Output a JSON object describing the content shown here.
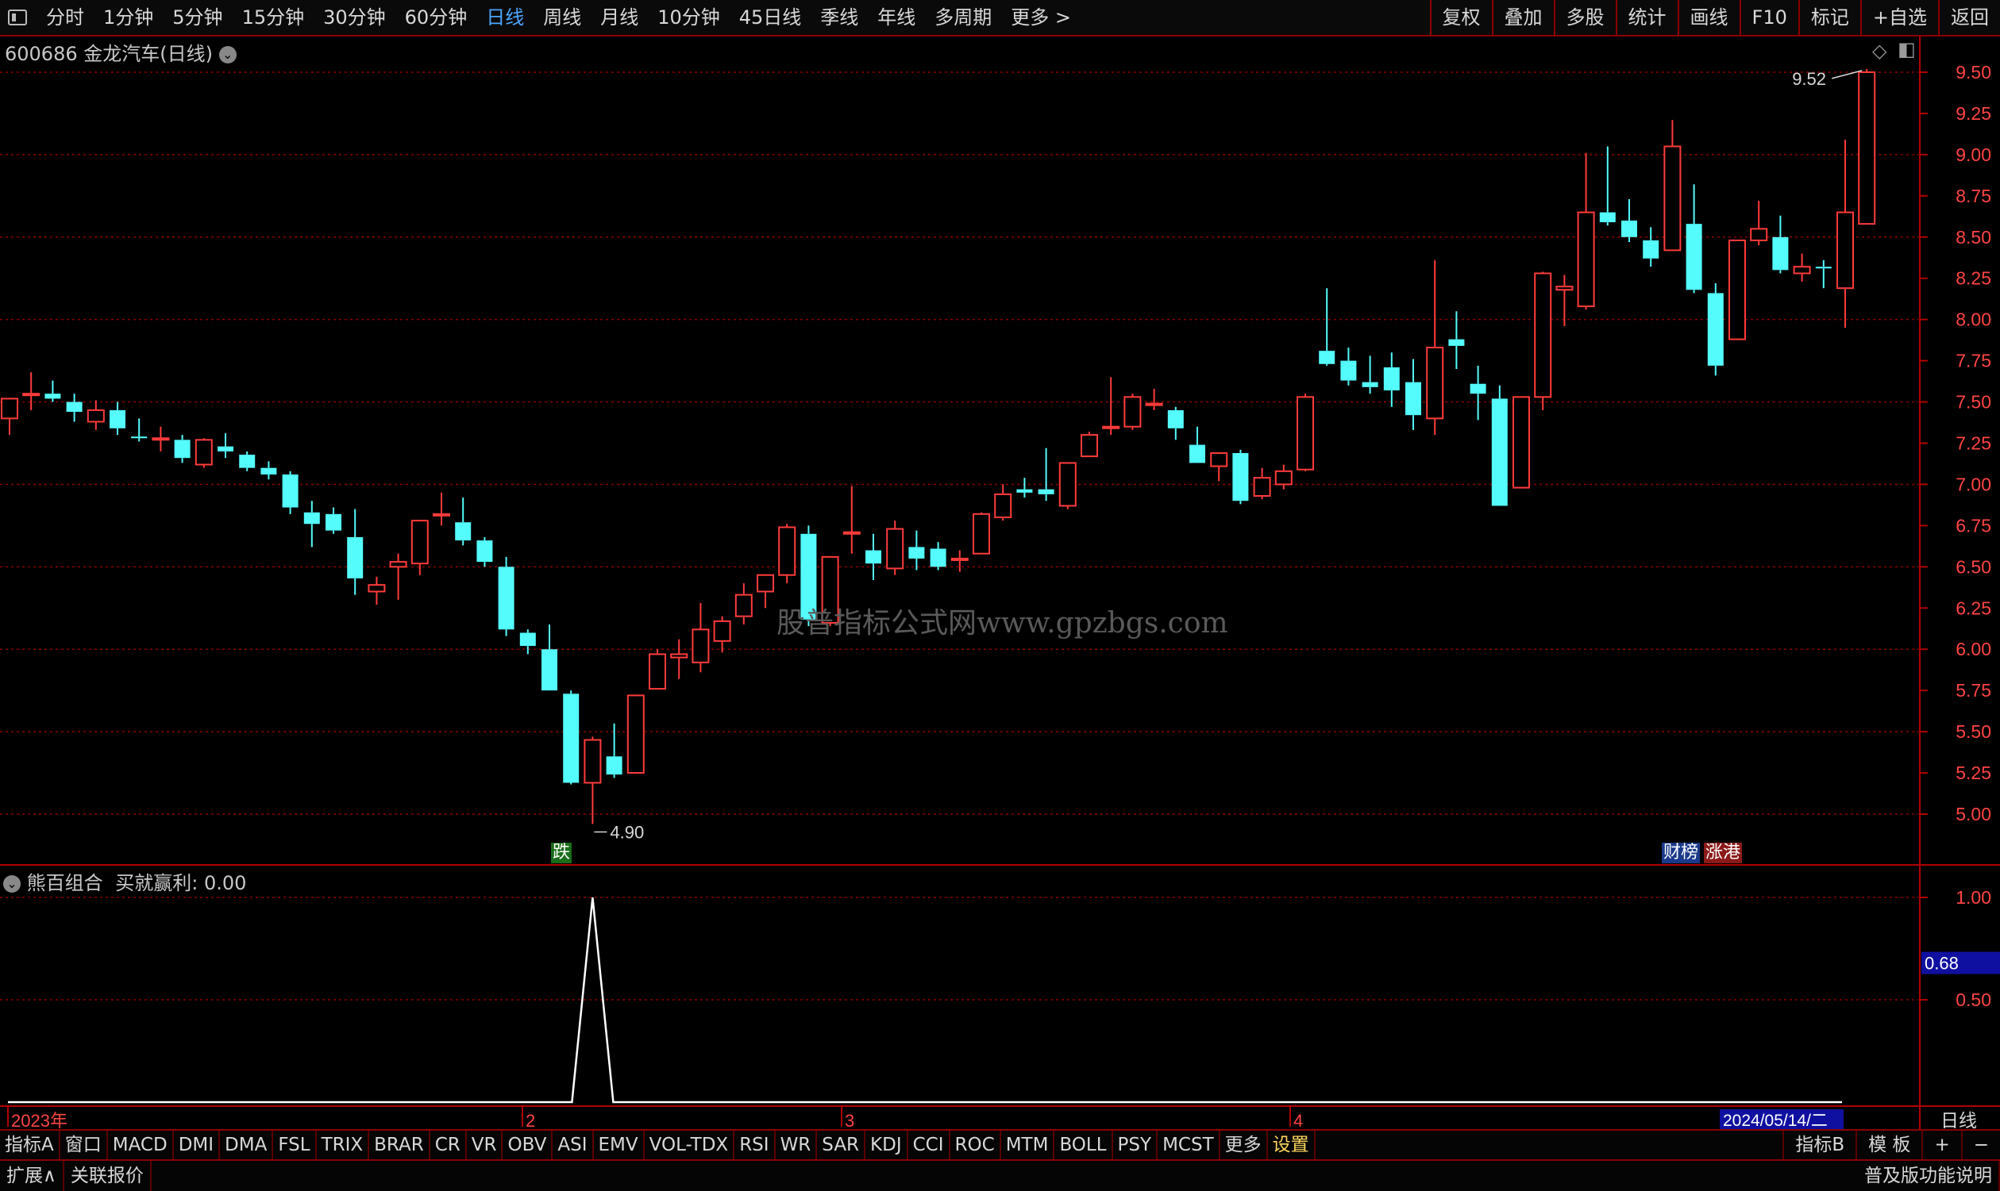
{
  "toolbar": {
    "periods": [
      "分时",
      "1分钟",
      "5分钟",
      "15分钟",
      "30分钟",
      "60分钟",
      "日线",
      "周线",
      "月线",
      "10分钟",
      "45日线",
      "季线",
      "年线",
      "多周期",
      "更多 >"
    ],
    "active_period": "日线",
    "right_buttons": [
      "复权",
      "叠加",
      "多股",
      "统计",
      "画线",
      "F10",
      "标记",
      "+自选",
      "返回"
    ]
  },
  "chart_header": {
    "code": "600686",
    "name_period": "金龙汽车(日线)"
  },
  "indicator_header": {
    "name": "熊百组合",
    "value_text": "买就赢利: 0.00"
  },
  "watermark": "股普指标公式网www.gpzbgs.com",
  "annotations": {
    "high_label": "9.52",
    "low_label": "4.90",
    "signal_tag": "跌",
    "tag_caibang": "财榜",
    "tag_zhanggang": "涨港"
  },
  "colors": {
    "up": "#ff3b3b",
    "down": "#54fcfc",
    "grid": "#8b0000",
    "frame": "#b00000"
  },
  "chart_data": {
    "type": "candlestick",
    "price_axis": {
      "min": 4.8,
      "max": 9.6,
      "ticks": [
        "9.50",
        "9.25",
        "9.00",
        "8.75",
        "8.50",
        "8.25",
        "8.00",
        "7.75",
        "7.50",
        "7.25",
        "7.00",
        "6.75",
        "6.50",
        "6.25",
        "6.00",
        "5.75",
        "5.50",
        "5.25",
        "5.00"
      ]
    },
    "indicator_axis": {
      "ticks": [
        "1.00",
        "0.50"
      ],
      "current": "0.68"
    },
    "x_labels": [
      "2023年",
      "2",
      "3",
      "4"
    ],
    "current_date": "2024/05/14/二",
    "period_label": "日线",
    "candles": [
      {
        "o": 7.4,
        "h": 7.5,
        "l": 7.3,
        "c": 7.52
      },
      {
        "o": 7.55,
        "h": 7.68,
        "l": 7.45,
        "c": 7.55
      },
      {
        "o": 7.55,
        "h": 7.63,
        "l": 7.5,
        "c": 7.52
      },
      {
        "o": 7.5,
        "h": 7.55,
        "l": 7.38,
        "c": 7.44
      },
      {
        "o": 7.38,
        "h": 7.51,
        "l": 7.33,
        "c": 7.45
      },
      {
        "o": 7.45,
        "h": 7.5,
        "l": 7.3,
        "c": 7.34
      },
      {
        "o": 7.29,
        "h": 7.4,
        "l": 7.26,
        "c": 7.28
      },
      {
        "o": 7.28,
        "h": 7.35,
        "l": 7.2,
        "c": 7.28
      },
      {
        "o": 7.27,
        "h": 7.3,
        "l": 7.13,
        "c": 7.16
      },
      {
        "o": 7.12,
        "h": 7.28,
        "l": 7.1,
        "c": 7.27
      },
      {
        "o": 7.23,
        "h": 7.31,
        "l": 7.16,
        "c": 7.2
      },
      {
        "o": 7.18,
        "h": 7.2,
        "l": 7.08,
        "c": 7.1
      },
      {
        "o": 7.1,
        "h": 7.14,
        "l": 7.03,
        "c": 7.06
      },
      {
        "o": 7.06,
        "h": 7.08,
        "l": 6.82,
        "c": 6.86
      },
      {
        "o": 6.83,
        "h": 6.9,
        "l": 6.62,
        "c": 6.76
      },
      {
        "o": 6.82,
        "h": 6.86,
        "l": 6.7,
        "c": 6.72
      },
      {
        "o": 6.68,
        "h": 6.85,
        "l": 6.33,
        "c": 6.43
      },
      {
        "o": 6.35,
        "h": 6.44,
        "l": 6.27,
        "c": 6.39
      },
      {
        "o": 6.5,
        "h": 6.58,
        "l": 6.3,
        "c": 6.53
      },
      {
        "o": 6.52,
        "h": 6.78,
        "l": 6.45,
        "c": 6.78
      },
      {
        "o": 6.82,
        "h": 6.95,
        "l": 6.75,
        "c": 6.82
      },
      {
        "o": 6.77,
        "h": 6.92,
        "l": 6.63,
        "c": 6.66
      },
      {
        "o": 6.66,
        "h": 6.68,
        "l": 6.5,
        "c": 6.53
      },
      {
        "o": 6.5,
        "h": 6.56,
        "l": 6.08,
        "c": 6.12
      },
      {
        "o": 6.1,
        "h": 6.12,
        "l": 5.97,
        "c": 6.02
      },
      {
        "o": 6.0,
        "h": 6.15,
        "l": 5.75,
        "c": 5.75
      },
      {
        "o": 5.73,
        "h": 5.75,
        "l": 5.18,
        "c": 5.19
      },
      {
        "o": 5.19,
        "h": 5.47,
        "l": 4.94,
        "c": 5.45
      },
      {
        "o": 5.35,
        "h": 5.55,
        "l": 5.22,
        "c": 5.24
      },
      {
        "o": 5.25,
        "h": 5.72,
        "l": 5.25,
        "c": 5.72
      },
      {
        "o": 5.76,
        "h": 6.0,
        "l": 5.76,
        "c": 5.97
      },
      {
        "o": 5.95,
        "h": 6.06,
        "l": 5.82,
        "c": 5.97
      },
      {
        "o": 5.92,
        "h": 6.28,
        "l": 5.86,
        "c": 6.12
      },
      {
        "o": 6.05,
        "h": 6.2,
        "l": 5.98,
        "c": 6.17
      },
      {
        "o": 6.2,
        "h": 6.4,
        "l": 6.15,
        "c": 6.33
      },
      {
        "o": 6.35,
        "h": 6.45,
        "l": 6.25,
        "c": 6.45
      },
      {
        "o": 6.45,
        "h": 6.76,
        "l": 6.4,
        "c": 6.74
      },
      {
        "o": 6.7,
        "h": 6.75,
        "l": 6.14,
        "c": 6.18
      },
      {
        "o": 6.16,
        "h": 6.56,
        "l": 6.14,
        "c": 6.56
      },
      {
        "o": 6.7,
        "h": 6.99,
        "l": 6.58,
        "c": 6.71
      },
      {
        "o": 6.6,
        "h": 6.7,
        "l": 6.42,
        "c": 6.52
      },
      {
        "o": 6.49,
        "h": 6.78,
        "l": 6.45,
        "c": 6.73
      },
      {
        "o": 6.62,
        "h": 6.72,
        "l": 6.48,
        "c": 6.55
      },
      {
        "o": 6.61,
        "h": 6.65,
        "l": 6.48,
        "c": 6.5
      },
      {
        "o": 6.55,
        "h": 6.6,
        "l": 6.47,
        "c": 6.55
      },
      {
        "o": 6.58,
        "h": 6.83,
        "l": 6.58,
        "c": 6.82
      },
      {
        "o": 6.8,
        "h": 7.0,
        "l": 6.78,
        "c": 6.94
      },
      {
        "o": 6.97,
        "h": 7.04,
        "l": 6.92,
        "c": 6.95
      },
      {
        "o": 6.97,
        "h": 7.22,
        "l": 6.9,
        "c": 6.94
      },
      {
        "o": 6.87,
        "h": 7.13,
        "l": 6.85,
        "c": 7.13
      },
      {
        "o": 7.17,
        "h": 7.32,
        "l": 7.17,
        "c": 7.3
      },
      {
        "o": 7.35,
        "h": 7.65,
        "l": 7.3,
        "c": 7.35
      },
      {
        "o": 7.35,
        "h": 7.55,
        "l": 7.33,
        "c": 7.53
      },
      {
        "o": 7.49,
        "h": 7.58,
        "l": 7.45,
        "c": 7.49
      },
      {
        "o": 7.45,
        "h": 7.47,
        "l": 7.27,
        "c": 7.34
      },
      {
        "o": 7.24,
        "h": 7.35,
        "l": 7.16,
        "c": 7.13
      },
      {
        "o": 7.11,
        "h": 7.14,
        "l": 7.02,
        "c": 7.19
      },
      {
        "o": 7.19,
        "h": 7.21,
        "l": 6.88,
        "c": 6.9
      },
      {
        "o": 6.93,
        "h": 7.1,
        "l": 6.91,
        "c": 7.04
      },
      {
        "o": 7.0,
        "h": 7.12,
        "l": 6.97,
        "c": 7.08
      },
      {
        "o": 7.09,
        "h": 7.55,
        "l": 7.08,
        "c": 7.53
      },
      {
        "o": 7.81,
        "h": 8.19,
        "l": 7.72,
        "c": 7.73
      },
      {
        "o": 7.75,
        "h": 7.83,
        "l": 7.6,
        "c": 7.63
      },
      {
        "o": 7.62,
        "h": 7.78,
        "l": 7.55,
        "c": 7.59
      },
      {
        "o": 7.71,
        "h": 7.8,
        "l": 7.47,
        "c": 7.57
      },
      {
        "o": 7.62,
        "h": 7.76,
        "l": 7.33,
        "c": 7.42
      },
      {
        "o": 7.4,
        "h": 8.36,
        "l": 7.3,
        "c": 7.83
      },
      {
        "o": 7.88,
        "h": 8.05,
        "l": 7.7,
        "c": 7.84
      },
      {
        "o": 7.61,
        "h": 7.72,
        "l": 7.39,
        "c": 7.55
      },
      {
        "o": 7.52,
        "h": 7.6,
        "l": 6.88,
        "c": 6.87
      },
      {
        "o": 6.98,
        "h": 7.53,
        "l": 6.98,
        "c": 7.53
      },
      {
        "o": 7.53,
        "h": 8.29,
        "l": 7.45,
        "c": 8.28
      },
      {
        "o": 8.18,
        "h": 8.27,
        "l": 7.96,
        "c": 8.2
      },
      {
        "o": 8.08,
        "h": 9.01,
        "l": 8.06,
        "c": 8.65
      },
      {
        "o": 8.65,
        "h": 9.05,
        "l": 8.57,
        "c": 8.59
      },
      {
        "o": 8.6,
        "h": 8.73,
        "l": 8.47,
        "c": 8.5
      },
      {
        "o": 8.48,
        "h": 8.56,
        "l": 8.32,
        "c": 8.37
      },
      {
        "o": 8.42,
        "h": 9.21,
        "l": 8.42,
        "c": 9.05
      },
      {
        "o": 8.58,
        "h": 8.82,
        "l": 8.16,
        "c": 8.18
      },
      {
        "o": 8.16,
        "h": 8.22,
        "l": 7.66,
        "c": 7.72
      },
      {
        "o": 7.88,
        "h": 8.48,
        "l": 7.88,
        "c": 8.48
      },
      {
        "o": 8.48,
        "h": 8.72,
        "l": 8.45,
        "c": 8.55
      },
      {
        "o": 8.5,
        "h": 8.63,
        "l": 8.28,
        "c": 8.3
      },
      {
        "o": 8.28,
        "h": 8.4,
        "l": 8.23,
        "c": 8.32
      },
      {
        "o": 8.32,
        "h": 8.36,
        "l": 8.19,
        "c": 8.31
      },
      {
        "o": 8.19,
        "h": 9.09,
        "l": 7.95,
        "c": 8.65
      },
      {
        "o": 8.58,
        "h": 9.52,
        "l": 8.58,
        "c": 9.5
      }
    ],
    "indicator_signal": {
      "candle_index": 27,
      "value": 1.0
    }
  },
  "bottom_tabs": [
    "指标A",
    "窗口",
    "MACD",
    "DMI",
    "DMA",
    "FSL",
    "TRIX",
    "BRAR",
    "CR",
    "VR",
    "OBV",
    "ASI",
    "EMV",
    "VOL-TDX",
    "RSI",
    "WR",
    "SAR",
    "KDJ",
    "CCI",
    "ROC",
    "MTM",
    "BOLL",
    "PSY",
    "MCST",
    "更多",
    "设置"
  ],
  "bottom_right": [
    "指标B",
    "模 板",
    "+",
    "−"
  ],
  "status": {
    "left": [
      "扩展∧",
      "关联报价"
    ],
    "right": "普及版功能说明"
  }
}
